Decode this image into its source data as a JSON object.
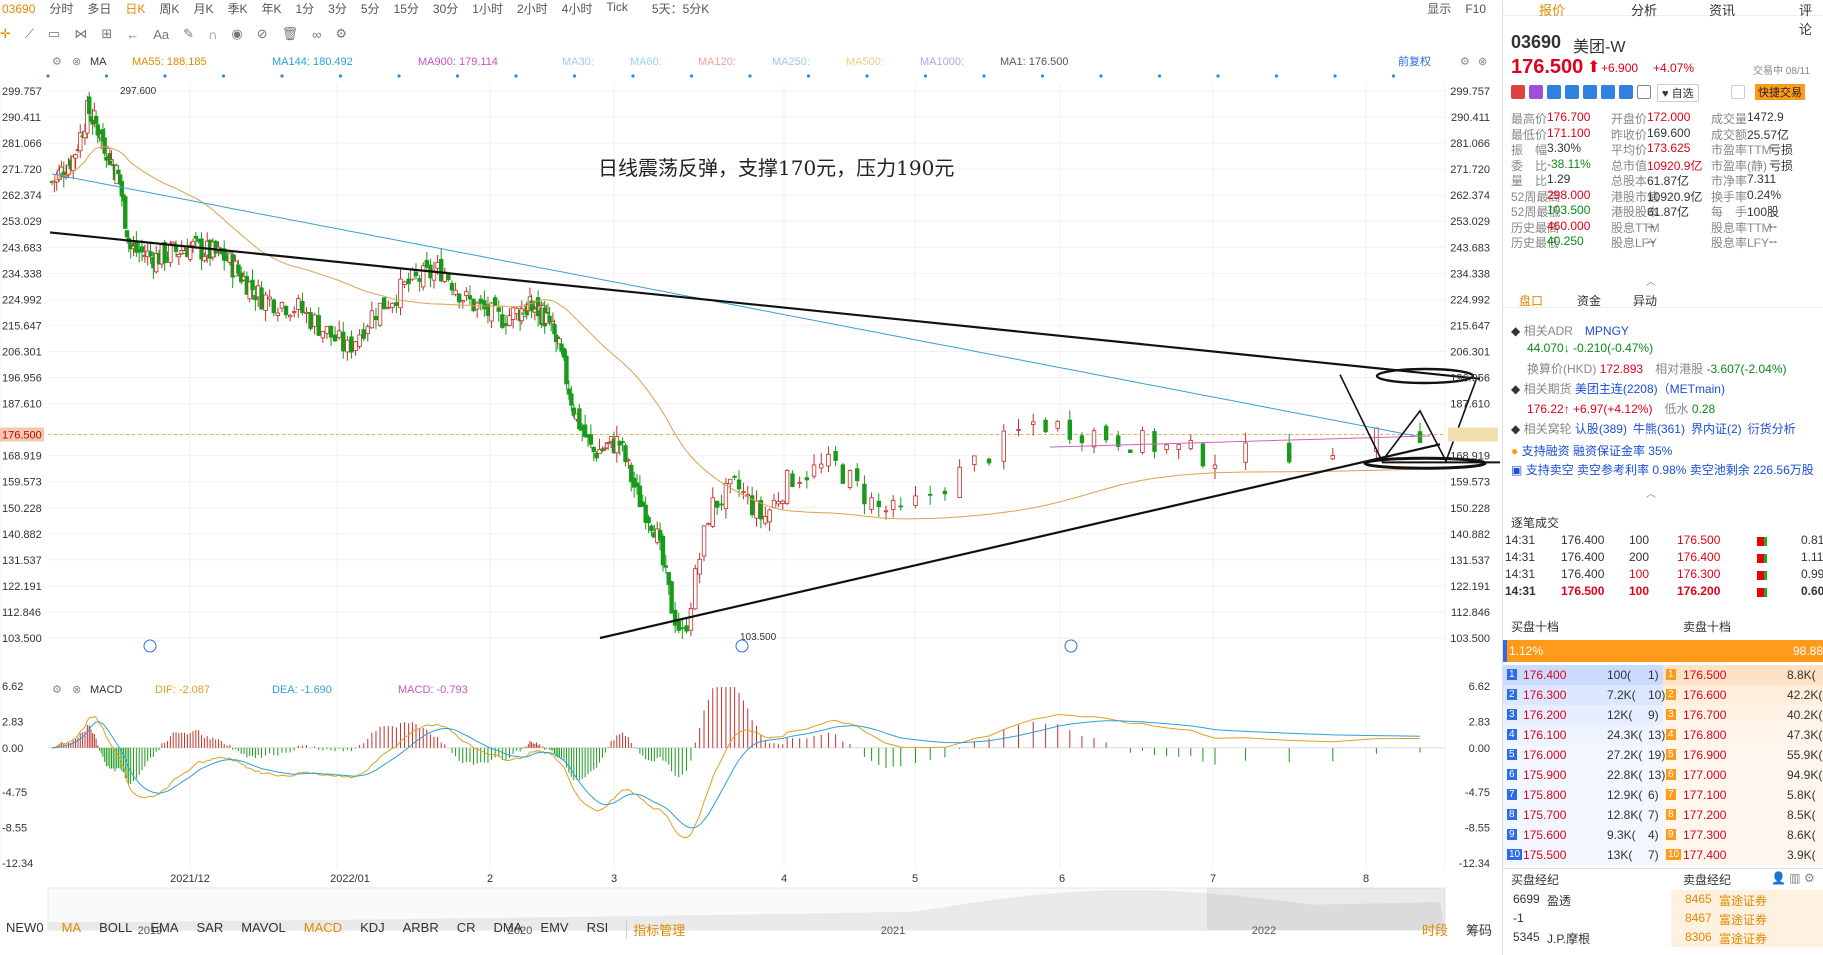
{
  "topbar": {
    "code": "03690",
    "periods": [
      "分时",
      "多日",
      "日K",
      "周K",
      "月K",
      "季K",
      "年K",
      "1分",
      "3分",
      "5分",
      "15分",
      "30分",
      "1小时",
      "2小时",
      "4小时",
      "Tick",
      "5天：5分K"
    ],
    "active_period": "日K",
    "right": [
      "显示",
      "F10"
    ]
  },
  "main": {
    "ma_legend": {
      "label": "MA",
      "ma55": "MA55: 188.185",
      "ma144": "MA144: 180.492",
      "ma900": "MA900: 179.114",
      "ma30": "MA30:",
      "ma60": "MA60:",
      "ma120": "MA120:",
      "ma250": "MA250:",
      "ma500": "MA500:",
      "ma1000": "MA1000:",
      "ma1": "MA1: 176.500",
      "adj": "前复权"
    },
    "annotation": "日线震荡反弹，支撑170元，压力190元",
    "price_ticks": [
      "299.757",
      "290.411",
      "281.066",
      "271.720",
      "262.374",
      "253.029",
      "243.683",
      "234.338",
      "224.992",
      "215.647",
      "206.301",
      "196.956",
      "187.610",
      "176.500",
      "168.919",
      "159.573",
      "150.228",
      "140.882",
      "131.537",
      "122.191",
      "112.846",
      "103.500"
    ],
    "right_ticks": [
      "299.757",
      "290.411",
      "281.066",
      "271.720",
      "262.374",
      "253.029",
      "243.683",
      "234.338",
      "224.992",
      "215.647",
      "206.301",
      "196.956",
      "187.610",
      "176.500",
      "168.919",
      "159.573",
      "150.228",
      "140.882",
      "131.537",
      "122.191",
      "112.846",
      "103.500"
    ],
    "high_label": "297.600",
    "low_label": "103.500",
    "macd_legend": {
      "label": "MACD",
      "dif": "DIF: -2.087",
      "dea": "DEA: -1.690",
      "macd": "MACD: -0.793"
    },
    "macd_ticks": [
      "6.62",
      "2.83",
      "0.00",
      "-4.75",
      "-8.55",
      "-12.34"
    ],
    "date_labels": [
      "2021/12",
      "2022/01",
      "2",
      "3",
      "4",
      "5",
      "6",
      "7",
      "8"
    ],
    "overview_labels": [
      "2019",
      "2020",
      "2021",
      "2022"
    ]
  },
  "bottom_tabs": [
    "NEW0",
    "MA",
    "BOLL",
    "EMA",
    "SAR",
    "MAVOL",
    "MACD",
    "KDJ",
    "ARBR",
    "CR",
    "DMA",
    "EMV",
    "RSI",
    "指标管理"
  ],
  "bottom_right": [
    "时段",
    "筹码"
  ],
  "panel": {
    "tabs": [
      "报价",
      "分析",
      "资讯",
      "评论"
    ],
    "code": "03690",
    "name": "美团-W",
    "price": "176.500",
    "change": "+6.900",
    "pct": "+4.07%",
    "status": "交易中 08/11",
    "watch_label": "自选",
    "quick_label": "快捷交易",
    "quote": [
      [
        "最高价",
        "176.700",
        "开盘价",
        "172.000",
        "成交量",
        "1472.9"
      ],
      [
        "最低价",
        "171.100",
        "昨收价",
        "169.600",
        "成交额",
        "25.57亿"
      ],
      [
        "振　幅",
        "3.30%",
        "平均价",
        "173.625",
        "市盈率TTM",
        "亏损"
      ],
      [
        "委　比",
        "-38.11%",
        "总市值",
        "10920.9亿",
        "市盈率(静)",
        "亏损"
      ],
      [
        "量　比",
        "1.29",
        "总股本",
        "61.87亿",
        "市净率",
        "7.311"
      ],
      [
        "52周最高",
        "298.000",
        "港股市值",
        "10920.9亿",
        "换手率",
        "0.24%"
      ],
      [
        "52周最低",
        "103.500",
        "港股股本",
        "61.87亿",
        "每　手",
        "100股"
      ],
      [
        "历史最高",
        "460.000",
        "股息TTM",
        "--",
        "股息率TTM",
        "--"
      ],
      [
        "历史最低",
        "40.250",
        "股息LFY",
        "--",
        "股息率LFY",
        "--"
      ]
    ],
    "subtabs": [
      "盘口",
      "资金",
      "异动"
    ],
    "adr": {
      "label": "相关ADR",
      "value": "MPNGY",
      "price": "44.070",
      "change": "-0.210(-0.47%)",
      "hk_label": "换算价(HKD)",
      "hk": "172.893",
      "rel_label": "相对港股",
      "rel": "-3.607(-2.04%)"
    },
    "futures": {
      "label": "相关期货",
      "value": "美团主连(2208)（METmain)",
      "price": "176.22",
      "change": "+6.97(+4.12%)",
      "gap_label": "低水",
      "gap": "0.28"
    },
    "warrants": {
      "label": "相关窝轮",
      "items": [
        "认股(389)",
        "牛熊(361)",
        "界内证(2)",
        "衍货分析"
      ]
    },
    "margin": {
      "label": "支持融资",
      "text": "融资保证金率 35%"
    },
    "short": {
      "label": "支持卖空",
      "text": "卖空参考利率 0.98%  卖空池剩余 226.56万股"
    },
    "ticks_title": "逐笔成交",
    "ticks": [
      [
        "14:31",
        "176.400",
        "100"
      ],
      [
        "14:31",
        "176.400",
        "200"
      ],
      [
        "14:31",
        "176.400",
        "100"
      ],
      [
        "14:31",
        "176.500",
        "100"
      ]
    ],
    "depth_prices": [
      "176.500",
      "176.400",
      "176.300",
      "176.200"
    ],
    "depth_vals": [
      "0.81",
      "1.11",
      "0.99",
      "0.60"
    ],
    "buy_title": "买盘十档",
    "sell_title": "卖盘十档",
    "ratio_buy": "1.12%",
    "ratio_sell": "98.88%",
    "book": [
      [
        "1",
        "176.400",
        "100(",
        "1)",
        "1",
        "176.500",
        "8.8K("
      ],
      [
        "2",
        "176.300",
        "7.2K(",
        "10)",
        "2",
        "176.600",
        "42.2K("
      ],
      [
        "3",
        "176.200",
        "12K(",
        "9)",
        "3",
        "176.700",
        "40.2K("
      ],
      [
        "4",
        "176.100",
        "24.3K(",
        "13)",
        "4",
        "176.800",
        "47.3K("
      ],
      [
        "5",
        "176.000",
        "27.2K(",
        "19)",
        "5",
        "176.900",
        "55.9K("
      ],
      [
        "6",
        "175.900",
        "22.8K(",
        "13)",
        "6",
        "177.000",
        "94.9K("
      ],
      [
        "7",
        "175.800",
        "12.9K(",
        "6)",
        "7",
        "177.100",
        "5.8K("
      ],
      [
        "8",
        "175.700",
        "12.8K(",
        "7)",
        "8",
        "177.200",
        "8.5K("
      ],
      [
        "9",
        "175.600",
        "9.3K(",
        "4)",
        "9",
        "177.300",
        "8.6K("
      ],
      [
        "10",
        "175.500",
        "13K(",
        "7)",
        "10",
        "177.400",
        "3.9K("
      ]
    ],
    "brokers_buy_title": "买盘经纪",
    "brokers_sell_title": "卖盘经纪",
    "brokers_buy": [
      [
        "6699",
        "盈透"
      ],
      [
        "-1",
        ""
      ],
      [
        "5345",
        "J.P.摩根"
      ]
    ],
    "brokers_sell": [
      [
        "8465",
        "富途证券"
      ],
      [
        "8467",
        "富途证券"
      ],
      [
        "8306",
        "富途证券"
      ]
    ]
  }
}
